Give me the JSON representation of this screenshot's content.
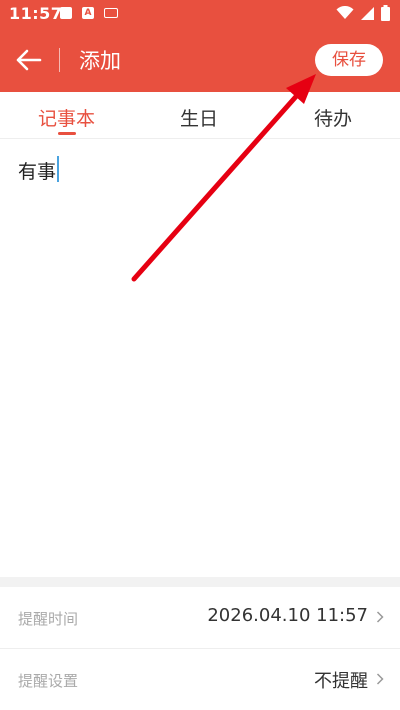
{
  "status_bar": {
    "time": "11:57"
  },
  "app_bar": {
    "title": "添加",
    "save_label": "保存"
  },
  "tabs": [
    {
      "label": "记事本",
      "active": true
    },
    {
      "label": "生日",
      "active": false
    },
    {
      "label": "待办",
      "active": false
    }
  ],
  "note": {
    "text": "有事"
  },
  "settings": [
    {
      "label": "提醒时间",
      "value": "2026.04.10 11:57"
    },
    {
      "label": "提醒设置",
      "value": "不提醒"
    }
  ],
  "colors": {
    "primary": "#e8503f",
    "annotation_arrow": "#e60012",
    "cursor": "#4aa3df"
  }
}
